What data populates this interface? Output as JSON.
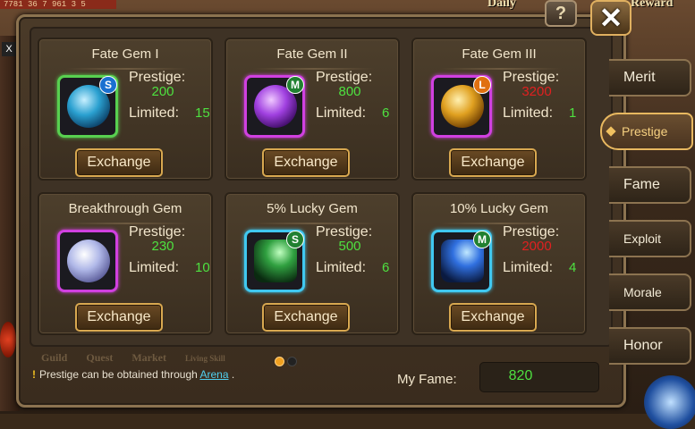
{
  "background": {
    "top_left_text": "7781 36 7 961 3 5",
    "daily_text": "Daily",
    "reward_text": "Reward"
  },
  "buttons": {
    "help": "?",
    "close": "✕"
  },
  "tabs": [
    {
      "label": "Merit"
    },
    {
      "label": "Prestige"
    },
    {
      "label": "Fame"
    },
    {
      "label": "Exploit"
    },
    {
      "label": "Morale"
    },
    {
      "label": "Honor"
    }
  ],
  "labels": {
    "prestige": "Prestige:",
    "limited": "Limited:",
    "exchange": "Exchange"
  },
  "items": [
    {
      "name": "Fate Gem I",
      "badge": "S",
      "prestige": "200",
      "limited": "15",
      "affordable": true,
      "icon": "blue-gem-orb-icon"
    },
    {
      "name": "Fate Gem II",
      "badge": "M",
      "prestige": "800",
      "limited": "6",
      "affordable": true,
      "icon": "purple-gem-orb-icon"
    },
    {
      "name": "Fate Gem III",
      "badge": "L",
      "prestige": "3200",
      "limited": "1",
      "affordable": false,
      "icon": "gold-gem-orb-icon"
    },
    {
      "name": "Breakthrough Gem",
      "badge": "",
      "prestige": "230",
      "limited": "10",
      "affordable": true,
      "icon": "glass-orb-icon"
    },
    {
      "name": "5% Lucky Gem",
      "badge": "S",
      "prestige": "500",
      "limited": "6",
      "affordable": true,
      "icon": "green-lucky-wand-icon"
    },
    {
      "name": "10% Lucky Gem",
      "badge": "M",
      "prestige": "2000",
      "limited": "4",
      "affordable": false,
      "icon": "blue-lucky-wand-icon"
    }
  ],
  "pagination": {
    "current": 1,
    "total": 2
  },
  "ghost_menu": [
    "Guild",
    "Quest",
    "Market",
    "Living Skill"
  ],
  "hint": {
    "icon": "!",
    "prefix": "Prestige can be obtained through ",
    "link": "Arena",
    "suffix": " ."
  },
  "fame": {
    "label": "My Fame:",
    "value": "820"
  }
}
